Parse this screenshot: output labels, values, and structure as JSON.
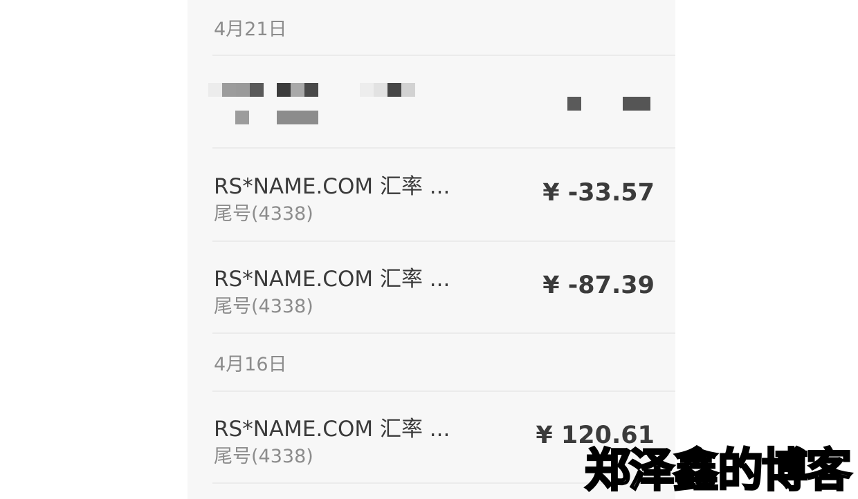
{
  "groups": [
    {
      "date": "4月21日"
    },
    {
      "date": "4月16日"
    }
  ],
  "transactions": [
    {
      "title": "RS*NAME.COM 汇率 ...",
      "card": "尾号(4338)",
      "amount": "¥ -33.57"
    },
    {
      "title": "RS*NAME.COM 汇率 ...",
      "card": "尾号(4338)",
      "amount": "¥ -87.39"
    },
    {
      "title": "RS*NAME.COM 汇率 ...",
      "card": "尾号(4338)",
      "amount": "¥ 120.61"
    }
  ],
  "watermark": "郑泽鑫的博客",
  "colors": {
    "panel_bg": "#f7f7f7",
    "primary_text": "#3a3a3a",
    "secondary_text": "#8c8c8c",
    "divider": "#ebebeb"
  }
}
